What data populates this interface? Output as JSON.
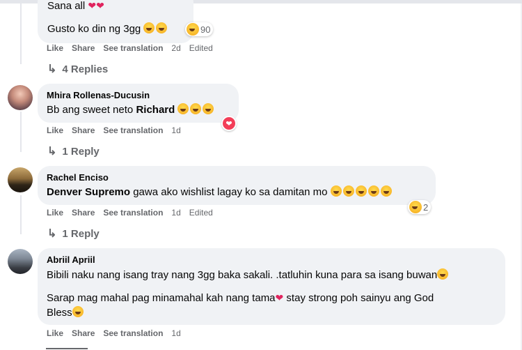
{
  "colors": {
    "bubble": "#f0f2f5",
    "meta_text": "#65676b",
    "love_red": "#f33e58"
  },
  "comment0": {
    "partial_text": "Sana all",
    "text": "Gusto ko din ng 3gg",
    "reaction_count": "90",
    "actions": {
      "like": "Like",
      "share": "Share",
      "translate": "See translation",
      "time": "2d",
      "edited": "Edited"
    },
    "replies": "4 Replies"
  },
  "comment1": {
    "name": "Mhira Rollenas-Ducusin",
    "text_prefix": "Bb ang sweet neto",
    "mention": "Richard",
    "reaction_icon": "love-heart-icon",
    "actions": {
      "like": "Like",
      "share": "Share",
      "translate": "See translation",
      "time": "1d"
    },
    "replies": "1 Reply"
  },
  "comment2": {
    "name": "Rachel Enciso",
    "mention": "Denver Supremo",
    "text": "gawa ako wishlist lagay ko sa damitan mo",
    "reaction_count": "2",
    "actions": {
      "like": "Like",
      "share": "Share",
      "translate": "See translation",
      "time": "1d",
      "edited": "Edited"
    },
    "replies": "1 Reply"
  },
  "comment3": {
    "name": "Abriil Apriil",
    "line1": "Bibili naku nang isang tray nang 3gg baka sakali. .tatluhin kuna para sa isang buwan",
    "line2": "Sarap mag mahal pag minamahal kah nang tama",
    "line2b": " stay strong poh sainyu ang God",
    "line3": "Bless",
    "actions": {
      "like": "Like",
      "share": "Share",
      "translate": "See translation",
      "time": "1d"
    }
  }
}
